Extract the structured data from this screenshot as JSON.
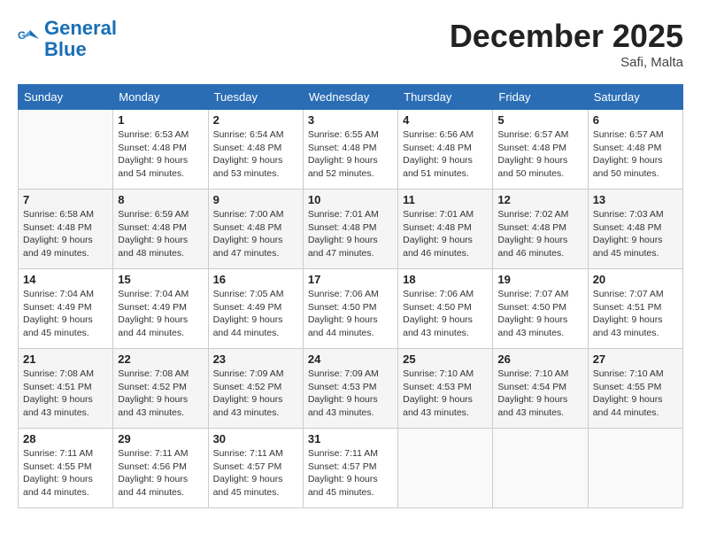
{
  "header": {
    "logo_line1": "General",
    "logo_line2": "Blue",
    "month_year": "December 2025",
    "location": "Safi, Malta"
  },
  "weekdays": [
    "Sunday",
    "Monday",
    "Tuesday",
    "Wednesday",
    "Thursday",
    "Friday",
    "Saturday"
  ],
  "weeks": [
    [
      {
        "day": "",
        "sunrise": "",
        "sunset": "",
        "daylight": ""
      },
      {
        "day": "1",
        "sunrise": "Sunrise: 6:53 AM",
        "sunset": "Sunset: 4:48 PM",
        "daylight": "Daylight: 9 hours and 54 minutes."
      },
      {
        "day": "2",
        "sunrise": "Sunrise: 6:54 AM",
        "sunset": "Sunset: 4:48 PM",
        "daylight": "Daylight: 9 hours and 53 minutes."
      },
      {
        "day": "3",
        "sunrise": "Sunrise: 6:55 AM",
        "sunset": "Sunset: 4:48 PM",
        "daylight": "Daylight: 9 hours and 52 minutes."
      },
      {
        "day": "4",
        "sunrise": "Sunrise: 6:56 AM",
        "sunset": "Sunset: 4:48 PM",
        "daylight": "Daylight: 9 hours and 51 minutes."
      },
      {
        "day": "5",
        "sunrise": "Sunrise: 6:57 AM",
        "sunset": "Sunset: 4:48 PM",
        "daylight": "Daylight: 9 hours and 50 minutes."
      },
      {
        "day": "6",
        "sunrise": "Sunrise: 6:57 AM",
        "sunset": "Sunset: 4:48 PM",
        "daylight": "Daylight: 9 hours and 50 minutes."
      }
    ],
    [
      {
        "day": "7",
        "sunrise": "Sunrise: 6:58 AM",
        "sunset": "Sunset: 4:48 PM",
        "daylight": "Daylight: 9 hours and 49 minutes."
      },
      {
        "day": "8",
        "sunrise": "Sunrise: 6:59 AM",
        "sunset": "Sunset: 4:48 PM",
        "daylight": "Daylight: 9 hours and 48 minutes."
      },
      {
        "day": "9",
        "sunrise": "Sunrise: 7:00 AM",
        "sunset": "Sunset: 4:48 PM",
        "daylight": "Daylight: 9 hours and 47 minutes."
      },
      {
        "day": "10",
        "sunrise": "Sunrise: 7:01 AM",
        "sunset": "Sunset: 4:48 PM",
        "daylight": "Daylight: 9 hours and 47 minutes."
      },
      {
        "day": "11",
        "sunrise": "Sunrise: 7:01 AM",
        "sunset": "Sunset: 4:48 PM",
        "daylight": "Daylight: 9 hours and 46 minutes."
      },
      {
        "day": "12",
        "sunrise": "Sunrise: 7:02 AM",
        "sunset": "Sunset: 4:48 PM",
        "daylight": "Daylight: 9 hours and 46 minutes."
      },
      {
        "day": "13",
        "sunrise": "Sunrise: 7:03 AM",
        "sunset": "Sunset: 4:48 PM",
        "daylight": "Daylight: 9 hours and 45 minutes."
      }
    ],
    [
      {
        "day": "14",
        "sunrise": "Sunrise: 7:04 AM",
        "sunset": "Sunset: 4:49 PM",
        "daylight": "Daylight: 9 hours and 45 minutes."
      },
      {
        "day": "15",
        "sunrise": "Sunrise: 7:04 AM",
        "sunset": "Sunset: 4:49 PM",
        "daylight": "Daylight: 9 hours and 44 minutes."
      },
      {
        "day": "16",
        "sunrise": "Sunrise: 7:05 AM",
        "sunset": "Sunset: 4:49 PM",
        "daylight": "Daylight: 9 hours and 44 minutes."
      },
      {
        "day": "17",
        "sunrise": "Sunrise: 7:06 AM",
        "sunset": "Sunset: 4:50 PM",
        "daylight": "Daylight: 9 hours and 44 minutes."
      },
      {
        "day": "18",
        "sunrise": "Sunrise: 7:06 AM",
        "sunset": "Sunset: 4:50 PM",
        "daylight": "Daylight: 9 hours and 43 minutes."
      },
      {
        "day": "19",
        "sunrise": "Sunrise: 7:07 AM",
        "sunset": "Sunset: 4:50 PM",
        "daylight": "Daylight: 9 hours and 43 minutes."
      },
      {
        "day": "20",
        "sunrise": "Sunrise: 7:07 AM",
        "sunset": "Sunset: 4:51 PM",
        "daylight": "Daylight: 9 hours and 43 minutes."
      }
    ],
    [
      {
        "day": "21",
        "sunrise": "Sunrise: 7:08 AM",
        "sunset": "Sunset: 4:51 PM",
        "daylight": "Daylight: 9 hours and 43 minutes."
      },
      {
        "day": "22",
        "sunrise": "Sunrise: 7:08 AM",
        "sunset": "Sunset: 4:52 PM",
        "daylight": "Daylight: 9 hours and 43 minutes."
      },
      {
        "day": "23",
        "sunrise": "Sunrise: 7:09 AM",
        "sunset": "Sunset: 4:52 PM",
        "daylight": "Daylight: 9 hours and 43 minutes."
      },
      {
        "day": "24",
        "sunrise": "Sunrise: 7:09 AM",
        "sunset": "Sunset: 4:53 PM",
        "daylight": "Daylight: 9 hours and 43 minutes."
      },
      {
        "day": "25",
        "sunrise": "Sunrise: 7:10 AM",
        "sunset": "Sunset: 4:53 PM",
        "daylight": "Daylight: 9 hours and 43 minutes."
      },
      {
        "day": "26",
        "sunrise": "Sunrise: 7:10 AM",
        "sunset": "Sunset: 4:54 PM",
        "daylight": "Daylight: 9 hours and 43 minutes."
      },
      {
        "day": "27",
        "sunrise": "Sunrise: 7:10 AM",
        "sunset": "Sunset: 4:55 PM",
        "daylight": "Daylight: 9 hours and 44 minutes."
      }
    ],
    [
      {
        "day": "28",
        "sunrise": "Sunrise: 7:11 AM",
        "sunset": "Sunset: 4:55 PM",
        "daylight": "Daylight: 9 hours and 44 minutes."
      },
      {
        "day": "29",
        "sunrise": "Sunrise: 7:11 AM",
        "sunset": "Sunset: 4:56 PM",
        "daylight": "Daylight: 9 hours and 44 minutes."
      },
      {
        "day": "30",
        "sunrise": "Sunrise: 7:11 AM",
        "sunset": "Sunset: 4:57 PM",
        "daylight": "Daylight: 9 hours and 45 minutes."
      },
      {
        "day": "31",
        "sunrise": "Sunrise: 7:11 AM",
        "sunset": "Sunset: 4:57 PM",
        "daylight": "Daylight: 9 hours and 45 minutes."
      },
      {
        "day": "",
        "sunrise": "",
        "sunset": "",
        "daylight": ""
      },
      {
        "day": "",
        "sunrise": "",
        "sunset": "",
        "daylight": ""
      },
      {
        "day": "",
        "sunrise": "",
        "sunset": "",
        "daylight": ""
      }
    ]
  ]
}
